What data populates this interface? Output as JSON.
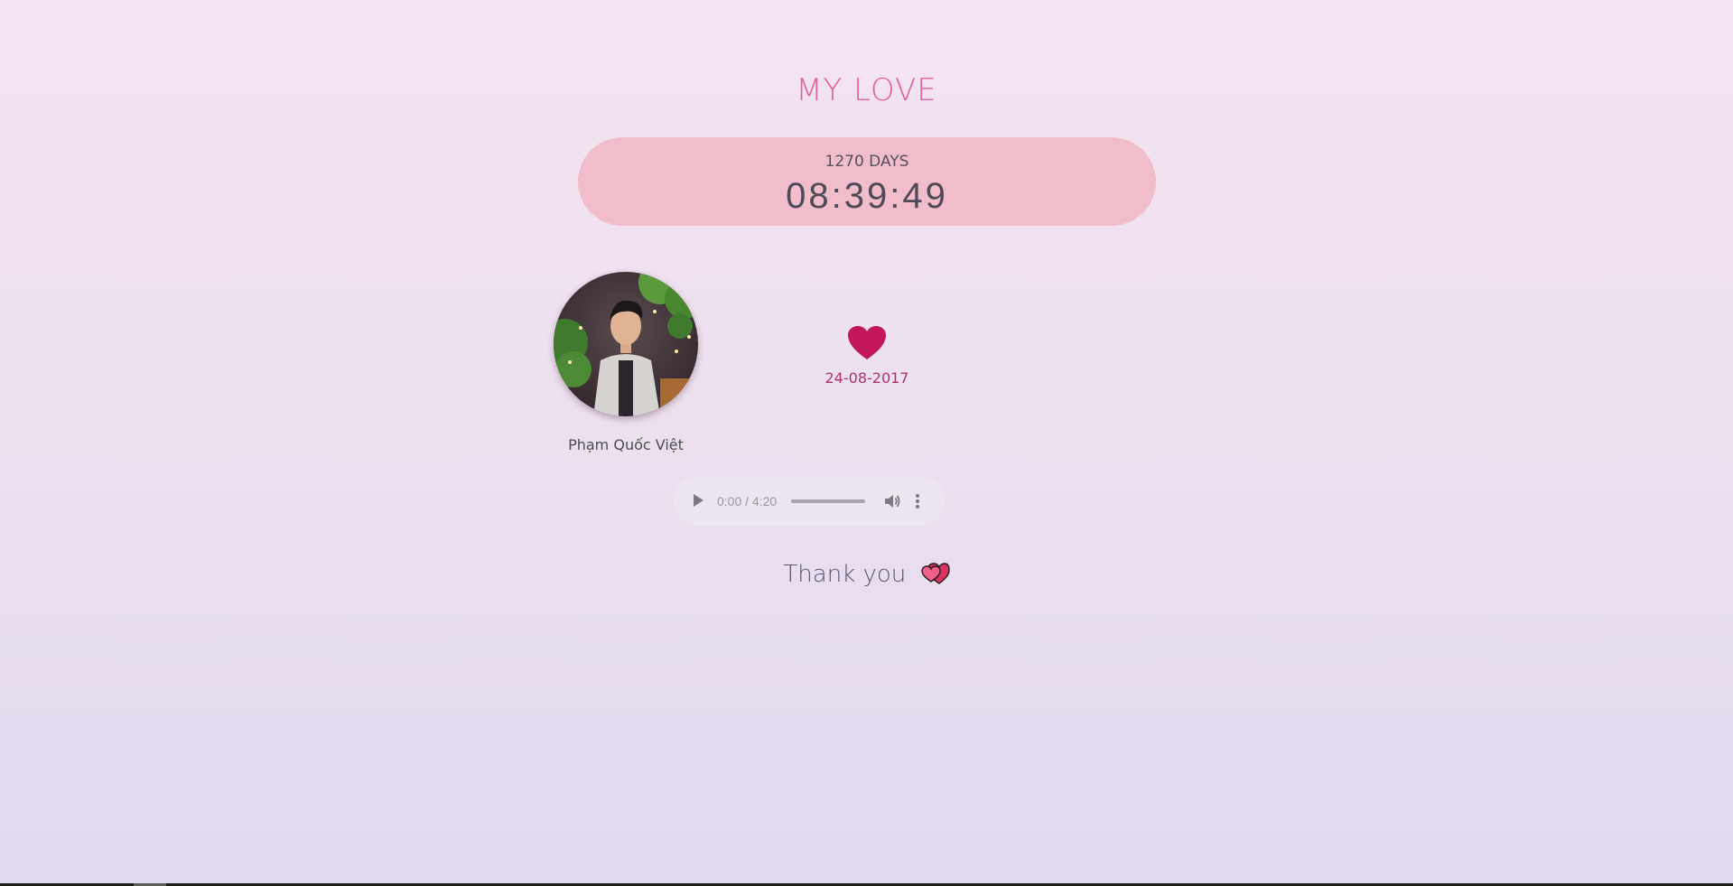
{
  "page": {
    "title": "MY LOVE"
  },
  "counter": {
    "days": "1270 DAYS",
    "clock": "08:39:49"
  },
  "profile": {
    "name": "Phạm Quốc Việt",
    "avatar_icon": "person-photo"
  },
  "anniversary": {
    "icon": "heart-icon",
    "date": "24-08-2017"
  },
  "audio": {
    "time": "0:00 / 4:20",
    "progress": 0.0,
    "play_icon": "play-icon",
    "volume_icon": "volume-icon",
    "menu_icon": "more-vertical-icon"
  },
  "footer": {
    "thanks": "Thank you",
    "icon": "two-hearts-icon"
  },
  "colors": {
    "title": "#e0609a",
    "pill": "#f2bdca",
    "heart": "#c2185b",
    "date": "#b0306f"
  }
}
